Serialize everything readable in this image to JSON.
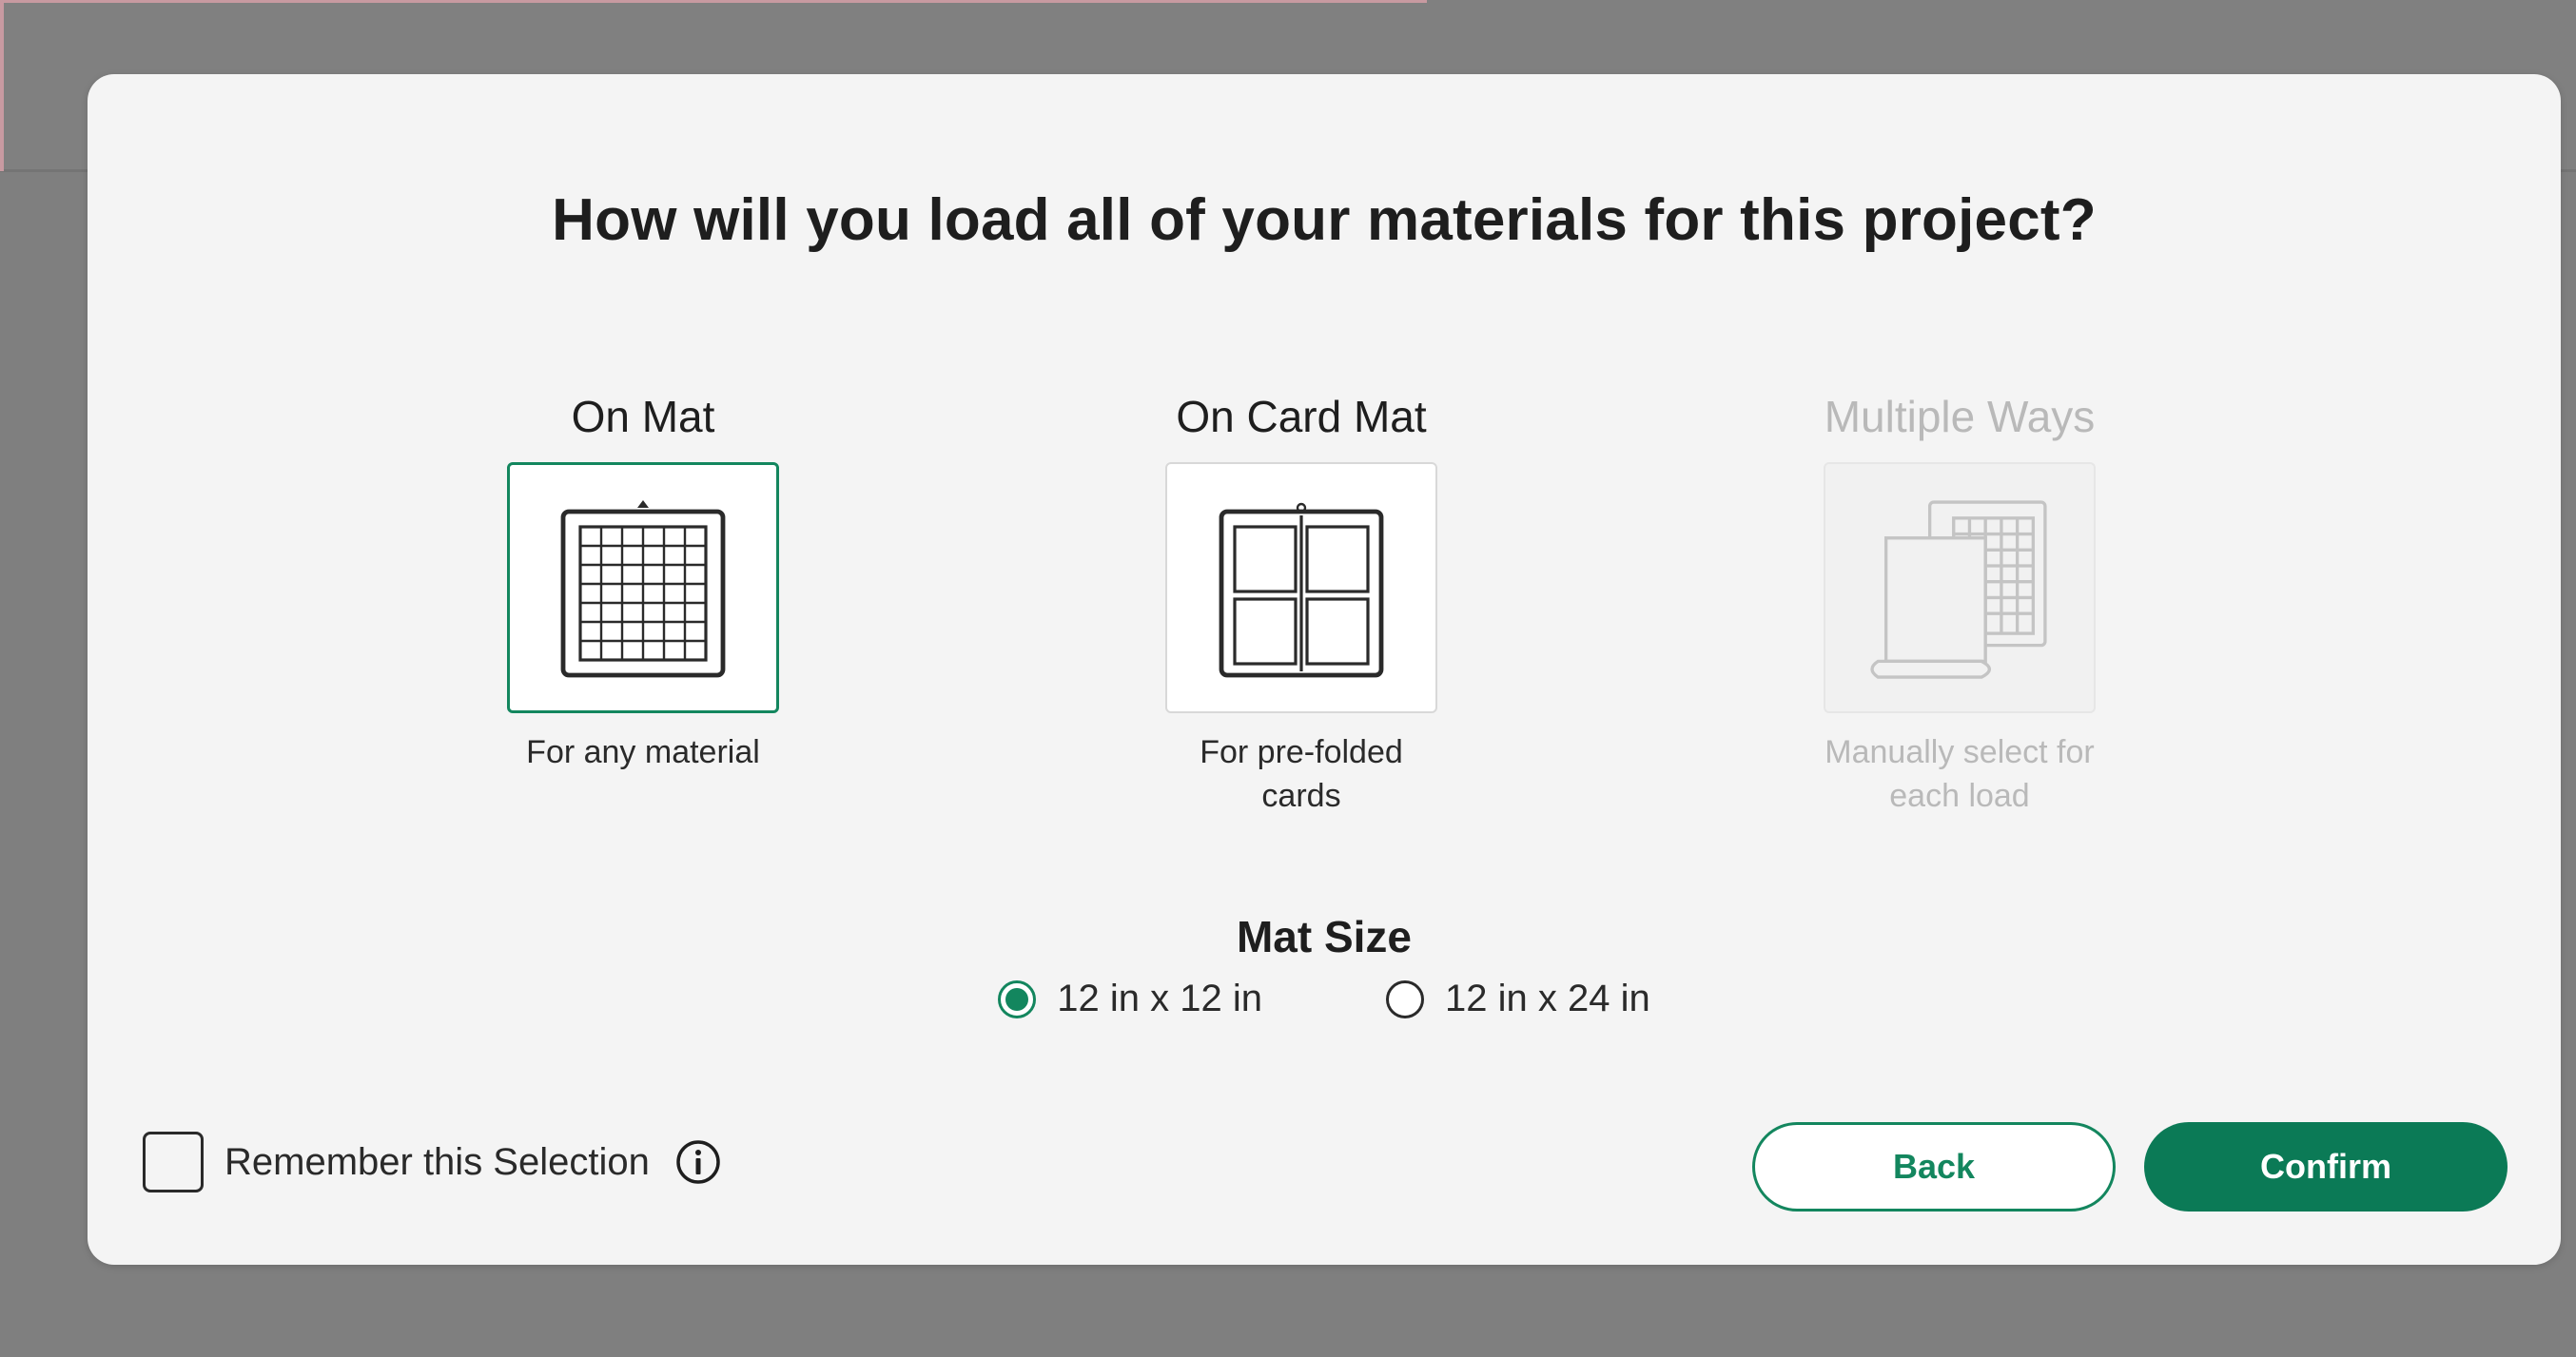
{
  "dialog": {
    "title": "How will you load all of your materials for this project?",
    "options": [
      {
        "title": "On Mat",
        "description": "For any material",
        "icon": "mat-grid-icon",
        "state": "selected"
      },
      {
        "title": "On Card Mat",
        "description": "For pre-folded cards",
        "icon": "card-mat-icon",
        "state": "enabled"
      },
      {
        "title": "Multiple Ways",
        "description": "Manually select for each load",
        "icon": "multiple-ways-icon",
        "state": "disabled"
      }
    ],
    "mat_size": {
      "title": "Mat Size",
      "options": [
        {
          "label": "12 in x 12 in",
          "checked": true
        },
        {
          "label": "12 in x 24 in",
          "checked": false
        }
      ]
    },
    "remember": {
      "label": "Remember this Selection",
      "checked": false,
      "icon": "info-icon"
    },
    "buttons": {
      "back": "Back",
      "confirm": "Confirm"
    }
  },
  "colors": {
    "accent": "#13865e",
    "confirm_bg": "#0b7a56",
    "overlay": "#7f7f7f",
    "dialog_bg": "#f4f4f4",
    "disabled_text": "#b9b9b9"
  }
}
